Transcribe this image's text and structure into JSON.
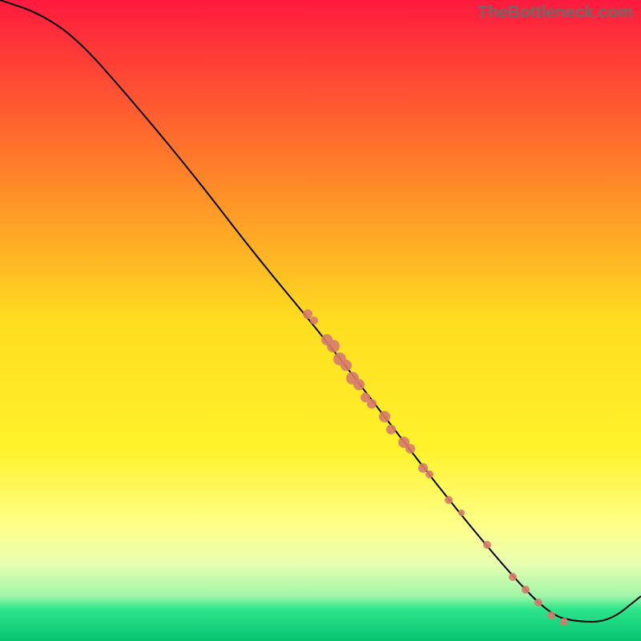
{
  "watermark": "TheBottleneck.com",
  "chart_data": {
    "type": "line",
    "title": "",
    "xlabel": "",
    "ylabel": "",
    "xlim": [
      0,
      100
    ],
    "ylim": [
      0,
      100
    ],
    "background_gradient": {
      "stops": [
        {
          "offset": 0,
          "color": "#ff1a3e"
        },
        {
          "offset": 25,
          "color": "#ff7a2a"
        },
        {
          "offset": 50,
          "color": "#ffdd20"
        },
        {
          "offset": 70,
          "color": "#fff22a"
        },
        {
          "offset": 82,
          "color": "#ffff88"
        },
        {
          "offset": 88,
          "color": "#e8ffb0"
        },
        {
          "offset": 93,
          "color": "#a0f5a8"
        },
        {
          "offset": 95,
          "color": "#2ee68a"
        },
        {
          "offset": 100,
          "color": "#06c270"
        }
      ]
    },
    "series": [
      {
        "name": "bottleneck-curve",
        "type": "line",
        "color": "#000000",
        "points": [
          {
            "x": 0,
            "y": 100
          },
          {
            "x": 6,
            "y": 98
          },
          {
            "x": 12,
            "y": 94
          },
          {
            "x": 20,
            "y": 85
          },
          {
            "x": 30,
            "y": 73
          },
          {
            "x": 40,
            "y": 60
          },
          {
            "x": 50,
            "y": 48
          },
          {
            "x": 60,
            "y": 35
          },
          {
            "x": 70,
            "y": 22
          },
          {
            "x": 80,
            "y": 10
          },
          {
            "x": 86,
            "y": 4
          },
          {
            "x": 90,
            "y": 3
          },
          {
            "x": 95,
            "y": 3
          },
          {
            "x": 100,
            "y": 7
          }
        ]
      },
      {
        "name": "data-points",
        "type": "scatter",
        "color": "#d87a6e",
        "points": [
          {
            "x": 48,
            "y": 51,
            "r": 6
          },
          {
            "x": 49,
            "y": 50,
            "r": 5
          },
          {
            "x": 51,
            "y": 47,
            "r": 7
          },
          {
            "x": 52,
            "y": 46,
            "r": 8
          },
          {
            "x": 53,
            "y": 44,
            "r": 8
          },
          {
            "x": 54,
            "y": 43,
            "r": 7
          },
          {
            "x": 55,
            "y": 41,
            "r": 8
          },
          {
            "x": 56,
            "y": 40,
            "r": 7
          },
          {
            "x": 57,
            "y": 38,
            "r": 6
          },
          {
            "x": 58,
            "y": 37,
            "r": 6
          },
          {
            "x": 60,
            "y": 35,
            "r": 7
          },
          {
            "x": 61,
            "y": 33,
            "r": 6
          },
          {
            "x": 63,
            "y": 31,
            "r": 7
          },
          {
            "x": 64,
            "y": 30,
            "r": 6
          },
          {
            "x": 66,
            "y": 27,
            "r": 6
          },
          {
            "x": 67,
            "y": 26,
            "r": 5
          },
          {
            "x": 70,
            "y": 22,
            "r": 5
          },
          {
            "x": 72,
            "y": 20,
            "r": 4
          },
          {
            "x": 76,
            "y": 15,
            "r": 5
          },
          {
            "x": 80,
            "y": 10,
            "r": 5
          },
          {
            "x": 82,
            "y": 8,
            "r": 5
          },
          {
            "x": 84,
            "y": 6,
            "r": 5
          },
          {
            "x": 86,
            "y": 4,
            "r": 5
          },
          {
            "x": 88,
            "y": 3,
            "r": 5
          }
        ]
      }
    ]
  }
}
